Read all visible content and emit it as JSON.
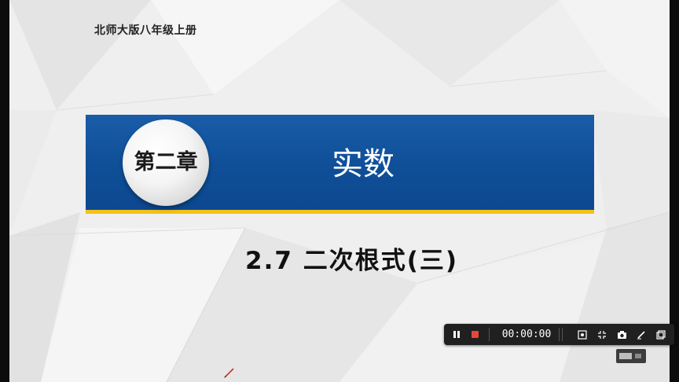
{
  "slide": {
    "publisher": "北师大版八年级上册",
    "chapter_label": "第二章",
    "chapter_title": "实数",
    "lesson_title": "2.7 二次根式(三)"
  },
  "colors": {
    "banner_blue": "#1558a6",
    "banner_gold": "#f2c21a",
    "slide_bg": "#efefef",
    "toolbar_bg": "#202020",
    "record_red": "#e8453c"
  },
  "recorder_toolbar": {
    "timer": "00:00:00",
    "icons": [
      "pause-icon",
      "stop-icon",
      "fullscreen-record-icon",
      "shrink-icon",
      "camera-icon",
      "pen-icon",
      "window-icon"
    ]
  }
}
